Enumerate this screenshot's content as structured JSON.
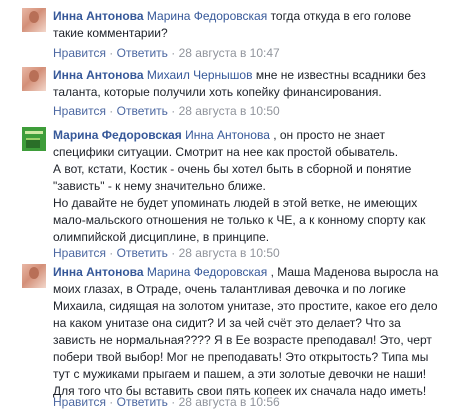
{
  "comments": [
    {
      "author": "Инна Антонова",
      "reply_to": "Марина Федоровская",
      "lines": [
        "тогда откуда в его голове",
        "такие комментарии?"
      ],
      "like": "Нравится",
      "reply": "Ответить",
      "time": "28 августа в 10:47"
    },
    {
      "author": "Инна Антонова",
      "reply_to": "Михаил Чернышов",
      "lines": [
        "мне не известны всадники без",
        "таланта, которые получили хоть копейку финансирования."
      ],
      "like": "Нравится",
      "reply": "Ответить",
      "time": "28 августа в 10:50"
    },
    {
      "author": "Марина Федоровская",
      "reply_to": "Инна Антонова",
      "lines": [
        ", он просто не знает",
        "специфики ситуации. Смотрит на нее как простой обыватель.",
        "А вот, кстати, Костик - очень бы хотел быть в сборной и понятие",
        "\"зависть\" - к нему значительно ближе.",
        "Но давайте не будет упоминать людей в этой ветке, не имеющих",
        "мало-мальского отношения не только к ЧЕ, а к конному спорту как",
        "олимпийской дисциплине, в принципе."
      ],
      "like": "Нравится",
      "reply": "Ответить",
      "time": "28 августа в 10:50"
    },
    {
      "author": "Инна Антонова",
      "reply_to": "Марина Федоровская",
      "lines": [
        ", Маша Маденова выросла на",
        "моих глазах, в Отраде, очень талантливая девочка и по логике",
        "Михаила, сидящая на золотом унитазе, это простите, какое его дело",
        "на каком унитазе она сидит? И за чей счёт это делает? Что за",
        "зависть не нормальная???? Я в Ее возрасте преподавал! Это, черт",
        "побери твой выбор! Мог не преподавать! Это открытость? Типа мы",
        "тут с мужиками прыгаем и пашем, а эти золотые девочки не наши!",
        "Для того что бы вставить свои пять копеек их сначала надо иметь!"
      ],
      "like": "Нравится",
      "reply": "Ответить",
      "time": "28 августа в 10:56"
    }
  ],
  "colors": {
    "link": "#365899",
    "meta": "#90949c",
    "text": "#1d2129"
  }
}
